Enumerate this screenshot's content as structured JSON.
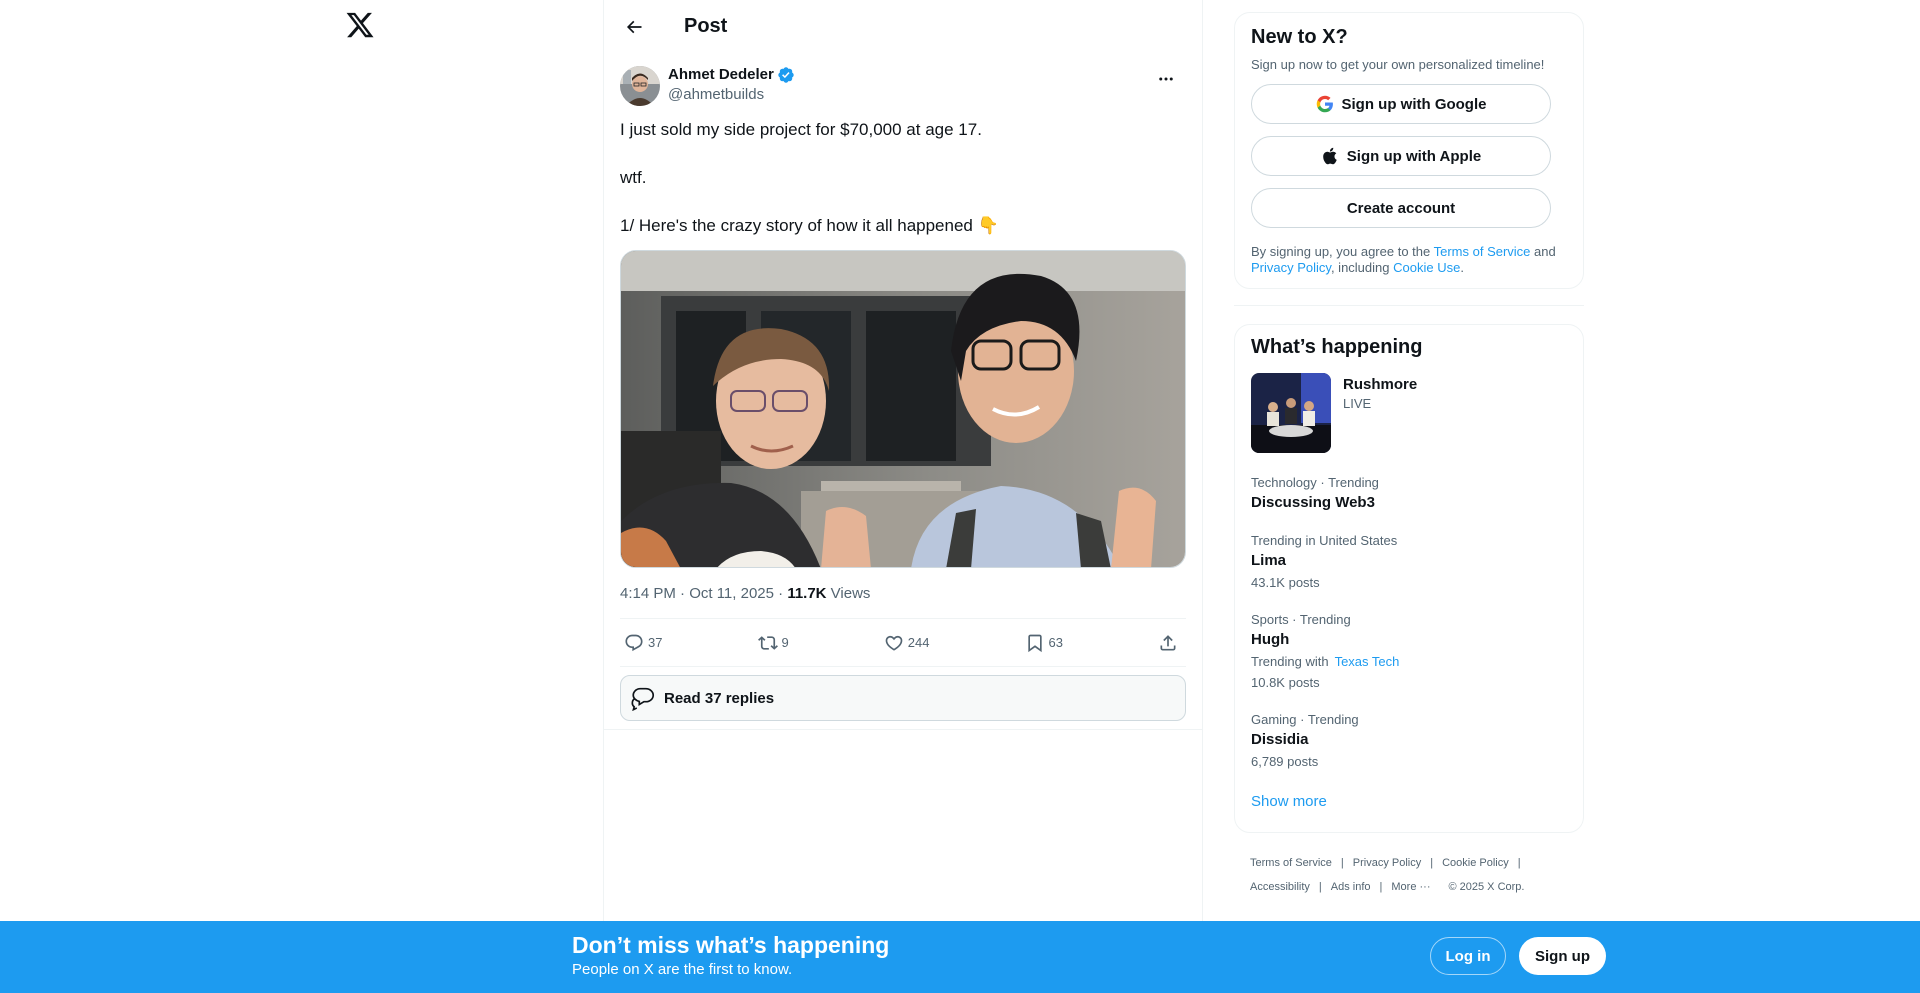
{
  "header": {
    "title": "Post",
    "back_icon": "arrow-left-icon"
  },
  "post": {
    "author_name": "Ahmet Dedeler",
    "handle": "@ahmetbuilds",
    "text_lines": [
      "I just sold my side project for $70,000 at age 17.",
      "wtf.",
      "1/ Here's the crazy story of how it all happened 👇"
    ],
    "time": "4:14 PM · Oct 11, 2025 · ",
    "views_count": "11.7K",
    "views_label": " Views",
    "actions": {
      "replies": "37",
      "reposts": "9",
      "likes": "244",
      "bookmarks": "63"
    },
    "read_replies": "Read 37 replies"
  },
  "sidebar": {
    "new_to_x": {
      "title": "New to X?",
      "subtitle": "Sign up now to get your own personalized timeline!",
      "google": "Sign up with Google",
      "apple": "Sign up with Apple",
      "create": "Create account",
      "legal_prefix": "By signing up, you agree to the ",
      "terms": "Terms of Service",
      "and": " and ",
      "privacy": "Privacy Policy",
      "including": ", including ",
      "cookie": "Cookie Use",
      "period": "."
    },
    "happening": {
      "title": "What’s happening",
      "live": {
        "title": "Rushmore",
        "badge": "LIVE"
      },
      "trends": [
        {
          "meta": "Technology · Trending",
          "name": "Discussing Web3"
        },
        {
          "meta": "Trending in United States",
          "name": "Lima",
          "posts": "43.1K posts"
        },
        {
          "meta": "Sports · Trending",
          "name": "Hugh",
          "with_label": "Trending with",
          "with_link": "Texas Tech",
          "posts": "10.8K posts"
        },
        {
          "meta": "Gaming · Trending",
          "name": "Dissidia",
          "posts": "6,789 posts"
        }
      ],
      "show_more": "Show more"
    },
    "footer": {
      "links": [
        "Terms of Service",
        "Privacy Policy",
        "Cookie Policy",
        "Accessibility",
        "Ads info",
        "More ···"
      ],
      "copyright": "© 2025 X Corp."
    }
  },
  "bottom_bar": {
    "title": "Don’t miss what’s happening",
    "subtitle": "People on X are the first to know.",
    "login": "Log in",
    "signup": "Sign up"
  },
  "colors": {
    "accent": "#1d9bf0",
    "text": "#0f1419",
    "muted": "#536471",
    "border": "#eff3f4"
  }
}
